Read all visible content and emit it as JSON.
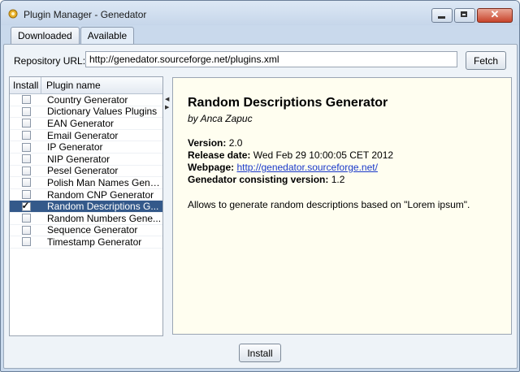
{
  "window": {
    "title": "Plugin Manager - Genedator",
    "controls": {
      "minimize": "",
      "maximize": "",
      "close": "✕"
    }
  },
  "tabs": [
    {
      "label": "Downloaded",
      "active": false
    },
    {
      "label": "Available",
      "active": true
    }
  ],
  "repository": {
    "label": "Repository URL:",
    "value": "http://genedator.sourceforge.net/plugins.xml",
    "fetch_label": "Fetch"
  },
  "plugin_list": {
    "columns": {
      "install": "Install",
      "name": "Plugin name"
    },
    "rows": [
      {
        "name": "Country Generator",
        "checked": false,
        "selected": false
      },
      {
        "name": "Dictionary Values Plugins",
        "checked": false,
        "selected": false
      },
      {
        "name": "EAN Generator",
        "checked": false,
        "selected": false
      },
      {
        "name": "Email Generator",
        "checked": false,
        "selected": false
      },
      {
        "name": "IP Generator",
        "checked": false,
        "selected": false
      },
      {
        "name": "NIP Generator",
        "checked": false,
        "selected": false
      },
      {
        "name": "Pesel Generator",
        "checked": false,
        "selected": false
      },
      {
        "name": "Polish Man Names Gene...",
        "checked": false,
        "selected": false
      },
      {
        "name": "Random CNP Generator",
        "checked": false,
        "selected": false
      },
      {
        "name": "Random Descriptions G...",
        "checked": true,
        "selected": true
      },
      {
        "name": "Random Numbers Gene...",
        "checked": false,
        "selected": false
      },
      {
        "name": "Sequence Generator",
        "checked": false,
        "selected": false
      },
      {
        "name": "Timestamp Generator",
        "checked": false,
        "selected": false
      }
    ]
  },
  "details": {
    "title": "Random Descriptions Generator",
    "author": "by Anca Zapuc",
    "version_label": "Version:",
    "version": "2.0",
    "release_label": "Release date:",
    "release_date": "Wed Feb 29 10:00:05 CET 2012",
    "webpage_label": "Webpage:",
    "webpage": "http://genedator.sourceforge.net/",
    "consisting_label": "Genedator consisting version:",
    "consisting_version": "1.2",
    "description": "Allows to generate random descriptions based on \"Lorem ipsum\"."
  },
  "install_label": "Install",
  "colors": {
    "selection": "#34598a",
    "detail_bg": "#fffef0",
    "link": "#1a39c9"
  }
}
